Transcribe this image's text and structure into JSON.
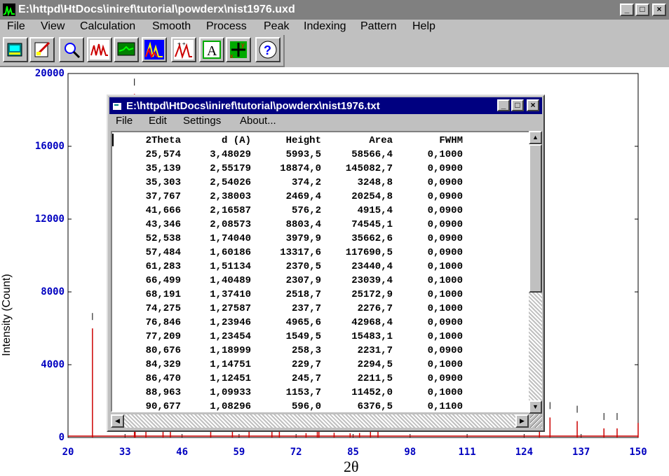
{
  "window": {
    "title": "E:\\httpd\\HtDocs\\iniref\\tutorial\\powderx\\nist1976.uxd",
    "controls": {
      "minimize": "_",
      "maximize": "□",
      "close": "×"
    }
  },
  "menu": [
    "File",
    "View",
    "Calculation",
    "Smooth",
    "Process",
    "Peak",
    "Indexing",
    "Pattern",
    "Help"
  ],
  "toolbar": [
    "open-file-icon",
    "edit-icon",
    "zoom-icon",
    "peak-search-icon",
    "background-icon",
    "pattern-compare-icon",
    "indexing-icon",
    "text-icon",
    "cursor-cross-icon",
    "help-icon"
  ],
  "chart_data": {
    "type": "line",
    "ylabel": "Intensity (Count)",
    "xlabel": "2θ",
    "xlim": [
      20,
      150
    ],
    "ylim": [
      0,
      20000
    ],
    "x_ticks": [
      "20",
      "33",
      "46",
      "59",
      "72",
      "85",
      "98",
      "111",
      "124",
      "137",
      "150"
    ],
    "y_ticks": [
      "0",
      "4000",
      "8000",
      "12000",
      "16000",
      "20000"
    ],
    "line_color": "#cc0000",
    "axis_label_color": "#0000c0",
    "peaks": [
      {
        "x": 25.574,
        "y": 5993.5
      },
      {
        "x": 35.139,
        "y": 18874.0
      },
      {
        "x": 35.303,
        "y": 374.2
      },
      {
        "x": 37.767,
        "y": 2469.4
      },
      {
        "x": 41.666,
        "y": 576.2
      },
      {
        "x": 43.346,
        "y": 8803.4
      },
      {
        "x": 52.538,
        "y": 3979.9
      },
      {
        "x": 57.484,
        "y": 13317.6
      },
      {
        "x": 61.283,
        "y": 2370.5
      },
      {
        "x": 66.499,
        "y": 2307.9
      },
      {
        "x": 68.191,
        "y": 2518.7
      },
      {
        "x": 74.275,
        "y": 237.7
      },
      {
        "x": 76.846,
        "y": 4965.6
      },
      {
        "x": 77.209,
        "y": 1549.5
      },
      {
        "x": 80.676,
        "y": 258.3
      },
      {
        "x": 84.329,
        "y": 229.7
      },
      {
        "x": 86.47,
        "y": 245.7
      },
      {
        "x": 88.963,
        "y": 1153.7
      },
      {
        "x": 90.677,
        "y": 596.0
      },
      {
        "x": 127.5,
        "y": 700
      },
      {
        "x": 129.9,
        "y": 1100
      },
      {
        "x": 136.1,
        "y": 900
      },
      {
        "x": 142.2,
        "y": 500
      },
      {
        "x": 145.2,
        "y": 500
      },
      {
        "x": 150.0,
        "y": 800
      }
    ]
  },
  "child_window": {
    "title": "E:\\httpd\\HtDocs\\iniref\\tutorial\\powderx\\nist1976.txt",
    "menu": [
      "File",
      "Edit",
      "Settings",
      "About..."
    ],
    "columns": [
      "2Theta",
      "d (A)",
      "Height",
      "Area",
      "FWHM"
    ],
    "rows": [
      [
        "25,574",
        "3,48029",
        "5993,5",
        "58566,4",
        "0,1000"
      ],
      [
        "35,139",
        "2,55179",
        "18874,0",
        "145082,7",
        "0,0900"
      ],
      [
        "35,303",
        "2,54026",
        "374,2",
        "3248,8",
        "0,0900"
      ],
      [
        "37,767",
        "2,38003",
        "2469,4",
        "20254,8",
        "0,0900"
      ],
      [
        "41,666",
        "2,16587",
        "576,2",
        "4915,4",
        "0,0900"
      ],
      [
        "43,346",
        "2,08573",
        "8803,4",
        "74545,1",
        "0,0900"
      ],
      [
        "52,538",
        "1,74040",
        "3979,9",
        "35662,6",
        "0,0900"
      ],
      [
        "57,484",
        "1,60186",
        "13317,6",
        "117690,5",
        "0,0900"
      ],
      [
        "61,283",
        "1,51134",
        "2370,5",
        "23440,4",
        "0,1000"
      ],
      [
        "66,499",
        "1,40489",
        "2307,9",
        "23039,4",
        "0,1000"
      ],
      [
        "68,191",
        "1,37410",
        "2518,7",
        "25172,9",
        "0,1000"
      ],
      [
        "74,275",
        "1,27587",
        "237,7",
        "2276,7",
        "0,1000"
      ],
      [
        "76,846",
        "1,23946",
        "4965,6",
        "42968,4",
        "0,0900"
      ],
      [
        "77,209",
        "1,23454",
        "1549,5",
        "15483,1",
        "0,1000"
      ],
      [
        "80,676",
        "1,18999",
        "258,3",
        "2231,7",
        "0,0900"
      ],
      [
        "84,329",
        "1,14751",
        "229,7",
        "2294,5",
        "0,1000"
      ],
      [
        "86,470",
        "1,12451",
        "245,7",
        "2211,5",
        "0,0900"
      ],
      [
        "88,963",
        "1,09933",
        "1153,7",
        "11452,0",
        "0,1000"
      ],
      [
        "90,677",
        "1,08296",
        "596,0",
        "6376,5",
        "0,1100"
      ]
    ]
  }
}
